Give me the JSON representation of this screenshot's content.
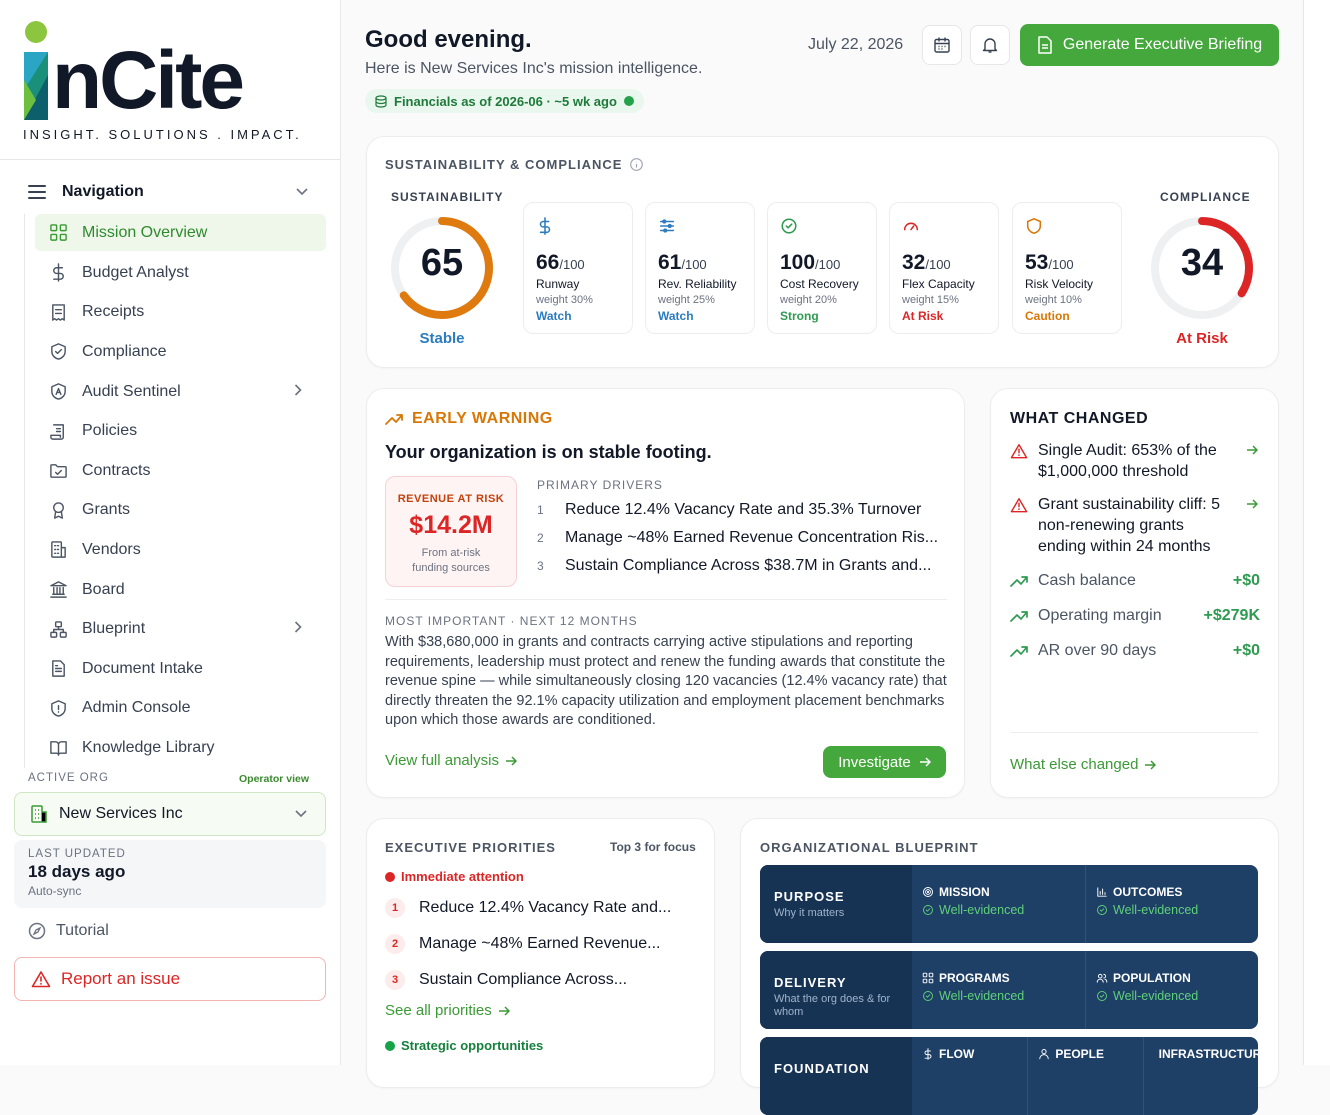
{
  "brand": {
    "logo_text": "inCite",
    "tagline": "INSIGHT. SOLUTIONS . IMPACT."
  },
  "nav": {
    "header": "Navigation",
    "items": [
      {
        "label": "Mission Overview",
        "icon": "grid-icon",
        "active": true
      },
      {
        "label": "Budget Analyst",
        "icon": "dollar-icon"
      },
      {
        "label": "Receipts",
        "icon": "receipt-icon"
      },
      {
        "label": "Compliance",
        "icon": "shield-check-icon"
      },
      {
        "label": "Audit Sentinel",
        "icon": "shield-a-icon",
        "chevron": true
      },
      {
        "label": "Policies",
        "icon": "scroll-icon"
      },
      {
        "label": "Contracts",
        "icon": "folder-icon"
      },
      {
        "label": "Grants",
        "icon": "award-icon"
      },
      {
        "label": "Vendors",
        "icon": "building-icon"
      },
      {
        "label": "Board",
        "icon": "landmark-icon"
      },
      {
        "label": "Blueprint",
        "icon": "network-icon",
        "chevron": true
      },
      {
        "label": "Document Intake",
        "icon": "file-text-icon"
      },
      {
        "label": "Admin Console",
        "icon": "shield-alert-icon"
      },
      {
        "label": "Knowledge Library",
        "icon": "book-open-icon"
      }
    ],
    "active_org_label": "ACTIVE ORG",
    "operator_view": "Operator view",
    "org_name": "New Services Inc",
    "last_updated_label": "LAST UPDATED",
    "last_updated_value": "18 days ago",
    "auto_sync": "Auto-sync",
    "tutorial": "Tutorial",
    "report": "Report an issue"
  },
  "header": {
    "greeting": "Good evening.",
    "subtitle": "Here is New Services Inc's mission intelligence.",
    "financials_badge": "Financials as of 2026-06 · ~5 wk ago",
    "date": "July 22, 2026",
    "generate_button": "Generate Executive Briefing"
  },
  "sustainability": {
    "section_title": "SUSTAINABILITY & COMPLIANCE",
    "sustainability_label": "SUSTAINABILITY",
    "score": "65",
    "score_fraction": 0.65,
    "status": "Stable",
    "compliance_label": "COMPLIANCE",
    "compliance_score": "34",
    "compliance_fraction": 0.34,
    "compliance_status": "At Risk",
    "metrics": [
      {
        "score": "66",
        "of": "/100",
        "name": "Runway",
        "weight": "weight 30%",
        "status": "Watch",
        "color": "#2b7bbf",
        "icon": "dollar-icon"
      },
      {
        "score": "61",
        "of": "/100",
        "name": "Rev. Reliability",
        "weight": "weight 25%",
        "status": "Watch",
        "color": "#2b7bbf",
        "icon": "sliders-icon"
      },
      {
        "score": "100",
        "of": "/100",
        "name": "Cost Recovery",
        "weight": "weight 20%",
        "status": "Strong",
        "color": "#2f9a52",
        "icon": "check-circle-icon"
      },
      {
        "score": "32",
        "of": "/100",
        "name": "Flex Capacity",
        "weight": "weight 15%",
        "status": "At Risk",
        "color": "#dc2626",
        "icon": "gauge-icon"
      },
      {
        "score": "53",
        "of": "/100",
        "name": "Risk Velocity",
        "weight": "weight 10%",
        "status": "Caution",
        "color": "#d97706",
        "icon": "shield-icon"
      }
    ]
  },
  "early_warning": {
    "title": "EARLY WARNING",
    "headline": "Your organization is on stable footing.",
    "rar_label": "REVENUE AT RISK",
    "rar_value": "$14.2M",
    "rar_sub": "From at-risk funding sources",
    "drivers_label": "PRIMARY DRIVERS",
    "drivers": [
      {
        "n": "1",
        "text": "Reduce 12.4% Vacancy Rate and 35.3% Turnover"
      },
      {
        "n": "2",
        "text": "Manage ~48% Earned Revenue Concentration Ris..."
      },
      {
        "n": "3",
        "text": "Sustain Compliance Across $38.7M in Grants and..."
      }
    ],
    "important_label": "MOST IMPORTANT · NEXT 12 MONTHS",
    "important_text": "With $38,680,000 in grants and contracts carrying active stipulations and reporting requirements, leadership must protect and renew the funding awards that constitute the revenue spine — while simultaneously closing 120 vacancies (12.4% vacancy rate) that directly threaten the 92.1% capacity utilization and employment placement benchmarks upon which those awards are conditioned.",
    "view_full": "View full analysis",
    "investigate": "Investigate"
  },
  "what_changed": {
    "title": "WHAT CHANGED",
    "alerts": [
      {
        "text": "Single Audit: 653% of the $1,000,000 threshold"
      },
      {
        "text": "Grant sustainability cliff: 5 non-renewing grants ending within 24 months"
      }
    ],
    "trends": [
      {
        "label": "Cash balance",
        "value": "+$0"
      },
      {
        "label": "Operating margin",
        "value": "+$279K"
      },
      {
        "label": "AR over 90 days",
        "value": "+$0"
      }
    ],
    "more": "What else changed"
  },
  "priorities": {
    "title": "EXECUTIVE PRIORITIES",
    "top": "Top 3 for focus",
    "immediate": "Immediate attention",
    "items": [
      {
        "n": "1",
        "text": "Reduce 12.4% Vacancy Rate and..."
      },
      {
        "n": "2",
        "text": "Manage ~48% Earned Revenue..."
      },
      {
        "n": "3",
        "text": "Sustain Compliance Across..."
      }
    ],
    "see_all": "See all priorities",
    "strategic": "Strategic opportunities"
  },
  "blueprint": {
    "title": "ORGANIZATIONAL BLUEPRINT",
    "rows": [
      {
        "label": "PURPOSE",
        "desc": "Why it matters",
        "cells": [
          {
            "name": "MISSION",
            "status": "Well-evidenced",
            "icon": "target-icon"
          },
          {
            "name": "OUTCOMES",
            "status": "Well-evidenced",
            "icon": "bar-chart-icon"
          }
        ]
      },
      {
        "label": "DELIVERY",
        "desc": "What the org does & for whom",
        "cells": [
          {
            "name": "PROGRAMS",
            "status": "Well-evidenced",
            "icon": "layout-grid-icon"
          },
          {
            "name": "POPULATION",
            "status": "Well-evidenced",
            "icon": "users-icon"
          }
        ]
      },
      {
        "label": "FOUNDATION",
        "desc": "",
        "cells": [
          {
            "name": "FLOW",
            "icon": "dollar-icon"
          },
          {
            "name": "PEOPLE",
            "icon": "user-icon"
          },
          {
            "name": "INFRASTRUCTURE",
            "icon": "network-icon"
          }
        ]
      }
    ]
  }
}
